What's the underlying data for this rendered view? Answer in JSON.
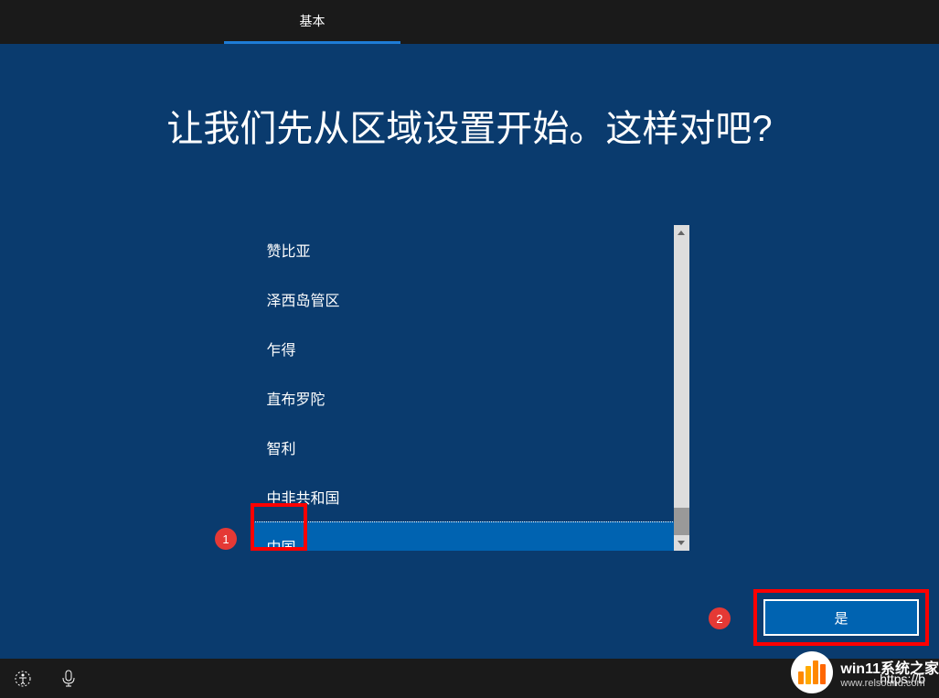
{
  "topbar": {
    "tab_label": "基本"
  },
  "main": {
    "heading": "让我们先从区域设置开始。这样对吧?",
    "regions": [
      "赞比亚",
      "泽西岛管区",
      "乍得",
      "直布罗陀",
      "智利",
      "中非共和国",
      "中国"
    ],
    "selected_index": 6
  },
  "annotations": {
    "badge1": "1",
    "badge2": "2"
  },
  "buttons": {
    "yes_label": "是"
  },
  "bottombar": {
    "url_text": "https://b"
  },
  "watermark": {
    "title": "win11系统之家",
    "url": "www.relsound.com"
  }
}
